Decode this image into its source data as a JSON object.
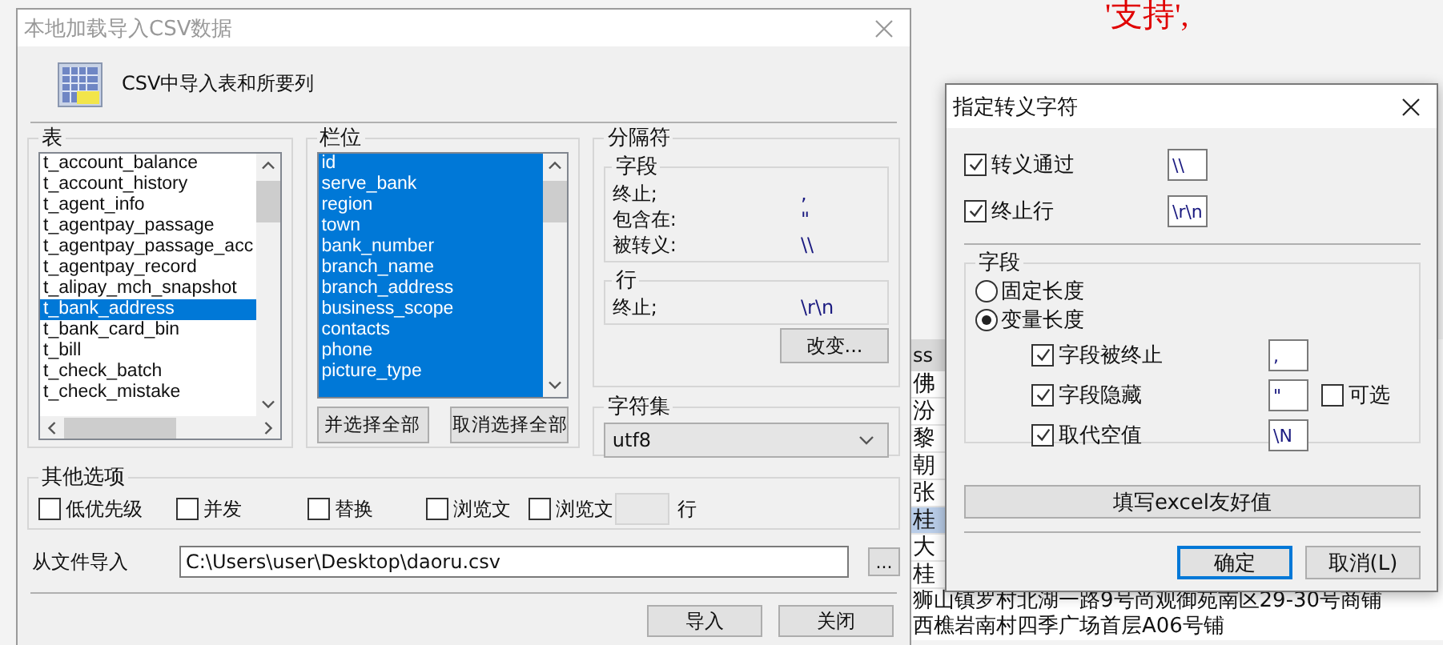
{
  "background": {
    "red_text": "'支持',",
    "table": {
      "header": "ss",
      "rows": [
        {
          "text": "佛",
          "selected": false
        },
        {
          "text": "汾",
          "selected": false
        },
        {
          "text": "黎",
          "selected": false
        },
        {
          "text": "朝",
          "selected": false
        },
        {
          "text": "张",
          "selected": false
        },
        {
          "text": "桂",
          "selected": true
        },
        {
          "text": "大",
          "selected": false
        },
        {
          "text": "桂",
          "selected": false
        }
      ],
      "wide_rows": [
        "狮山镇罗村北湖一路9号尚观御苑南区29-30号商铺",
        "西樵岩南村四季广场首层A06号铺"
      ]
    }
  },
  "import_dialog": {
    "title": "本地加载导入CSV数据",
    "heading": "CSV中导入表和所要列",
    "tables": {
      "label": "表",
      "items": [
        {
          "name": "t_account_balance",
          "selected": false
        },
        {
          "name": "t_account_history",
          "selected": false
        },
        {
          "name": "t_agent_info",
          "selected": false
        },
        {
          "name": "t_agentpay_passage",
          "selected": false
        },
        {
          "name": "t_agentpay_passage_acc",
          "selected": false
        },
        {
          "name": "t_agentpay_record",
          "selected": false
        },
        {
          "name": "t_alipay_mch_snapshot",
          "selected": false
        },
        {
          "name": "t_bank_address",
          "selected": true
        },
        {
          "name": "t_bank_card_bin",
          "selected": false
        },
        {
          "name": "t_bill",
          "selected": false
        },
        {
          "name": "t_check_batch",
          "selected": false
        },
        {
          "name": "t_check_mistake",
          "selected": false
        }
      ]
    },
    "columns": {
      "label": "栏位",
      "items": [
        {
          "name": "id",
          "selected": true
        },
        {
          "name": "serve_bank",
          "selected": true
        },
        {
          "name": "region",
          "selected": true
        },
        {
          "name": "town",
          "selected": true
        },
        {
          "name": "bank_number",
          "selected": true
        },
        {
          "name": "branch_name",
          "selected": true
        },
        {
          "name": "branch_address",
          "selected": true
        },
        {
          "name": "business_scope",
          "selected": true
        },
        {
          "name": "contacts",
          "selected": true
        },
        {
          "name": "phone",
          "selected": true
        },
        {
          "name": "picture_type",
          "selected": true
        }
      ],
      "buttons": [
        "并选择全部",
        "取消选择全部"
      ]
    },
    "delimiters": {
      "label": "分隔符",
      "field": {
        "label": "字段",
        "rows": [
          {
            "label": "终止;",
            "value": ","
          },
          {
            "label": "包含在:",
            "value": "\""
          },
          {
            "label": "被转义:",
            "value": "\\\\"
          }
        ]
      },
      "line": {
        "label": "行",
        "rows": [
          {
            "label": "终止;",
            "value": "\\r\\n"
          }
        ]
      },
      "change_button": "改变..."
    },
    "charset": {
      "label": "字符集",
      "value": "utf8"
    },
    "other_options": {
      "label": "其他选项",
      "checkboxes": [
        {
          "label": "低优先级",
          "checked": false
        },
        {
          "label": "并发",
          "checked": false
        },
        {
          "label": "替换",
          "checked": false
        },
        {
          "label": "浏览文",
          "checked": false
        },
        {
          "label": "浏览文",
          "checked": false
        }
      ],
      "suffix": "行"
    },
    "file": {
      "label": "从文件导入",
      "value": "C:\\Users\\user\\Desktop\\daoru.csv",
      "browse": "..."
    },
    "buttons": [
      "导入",
      "关闭"
    ]
  },
  "escape_dialog": {
    "title": "指定转义字符",
    "options": [
      {
        "label": "转义通过",
        "checked": true,
        "value": "\\\\"
      },
      {
        "label": "终止行",
        "checked": true,
        "value": "\\r\\n"
      }
    ],
    "field_group": {
      "label": "字段",
      "modes": [
        {
          "label": "固定长度",
          "selected": false
        },
        {
          "label": "变量长度",
          "selected": true
        }
      ],
      "options": [
        {
          "label": "字段被终止",
          "checked": true,
          "value": ","
        },
        {
          "label": "字段隐藏",
          "checked": true,
          "value": "\"",
          "optional": {
            "label": "可选",
            "checked": false
          }
        },
        {
          "label": "取代空值",
          "checked": true,
          "value": "\\N"
        }
      ]
    },
    "excel_button": "填写excel友好值",
    "buttons": [
      {
        "label": "确定",
        "default": true
      },
      {
        "label": "取消(L)",
        "default": false
      }
    ]
  }
}
